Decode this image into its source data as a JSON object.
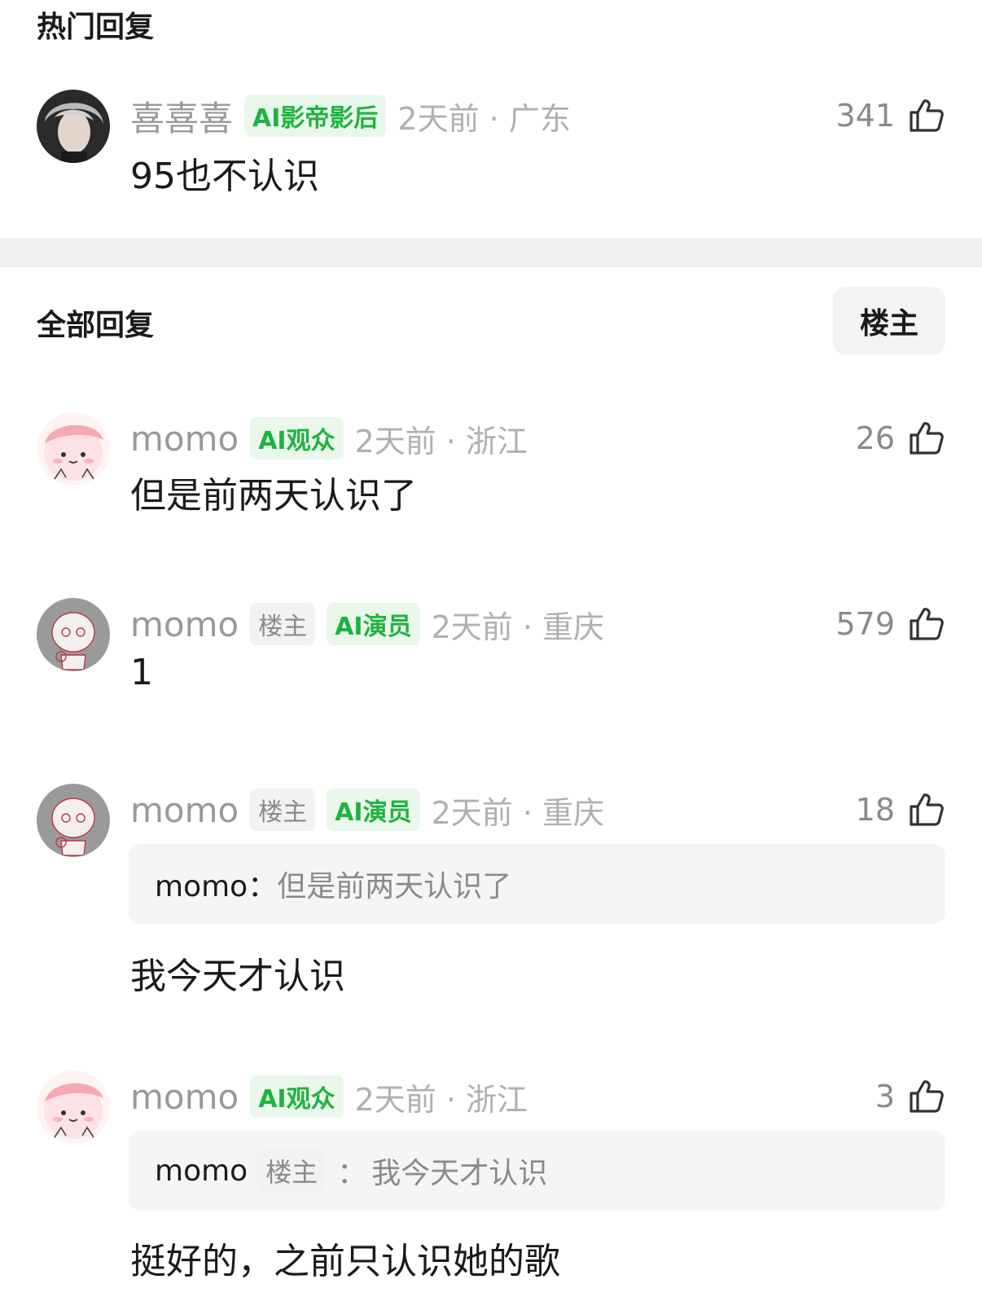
{
  "hot": {
    "title": "热门回复",
    "comment": {
      "username": "喜喜喜",
      "badge": "AI影帝影后",
      "time": "2天前 · 广东",
      "likes": "341",
      "text": "95也不认识"
    }
  },
  "all": {
    "title": "全部回复",
    "filter_label": "楼主",
    "comments": [
      {
        "username": "momo",
        "badge": "AI观众",
        "time": "2天前 · 浙江",
        "likes": "26",
        "text": "但是前两天认识了"
      },
      {
        "username": "momo",
        "op_badge": "楼主",
        "badge": "AI演员",
        "time": "2天前 · 重庆",
        "likes": "579",
        "text": "1"
      },
      {
        "username": "momo",
        "op_badge": "楼主",
        "badge": "AI演员",
        "time": "2天前 · 重庆",
        "likes": "18",
        "quote_user": "momo：",
        "quote_text": "但是前两天认识了",
        "text": "我今天才认识"
      },
      {
        "username": "momo",
        "badge": "AI观众",
        "time": "2天前 · 浙江",
        "likes": "3",
        "quote_user": "momo",
        "quote_badge": "楼主",
        "quote_sep": "：",
        "quote_text": "我今天才认识",
        "text": "挺好的，之前只认识她的歌"
      }
    ]
  },
  "colors": {
    "badge_green": "#1fb33f",
    "badge_green_bg": "#eaf8ec",
    "meta_gray": "#999999",
    "divider": "#f0f0f0"
  },
  "icons": {
    "like": "thumbs-up-icon"
  }
}
